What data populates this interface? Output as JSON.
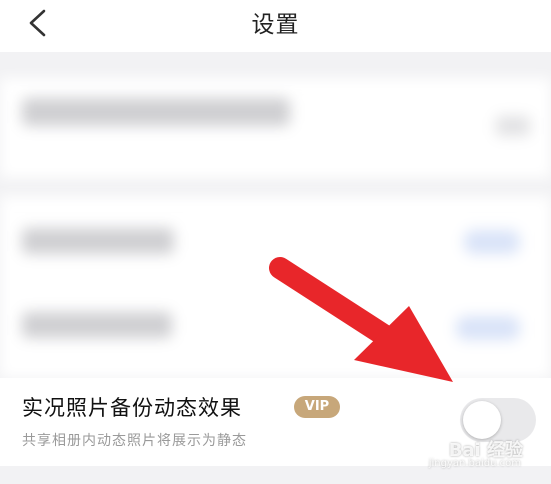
{
  "header": {
    "title": "设置",
    "back_icon": "chevron-left-icon"
  },
  "live_photo_setting": {
    "title": "实况照片备份动态效果",
    "badge": "VIP",
    "description": "共享相册内动态照片将展示为静态",
    "toggle_on": false
  },
  "annotation": {
    "arrow_color": "#e8262a",
    "arrow_icon": "red-arrow-icon"
  },
  "watermark": {
    "text": "Bai 经验",
    "subtext": "jingyan.baidu.com"
  },
  "colors": {
    "vip_badge": "#c7a77a",
    "toggle_off": "#e9e9eb"
  }
}
